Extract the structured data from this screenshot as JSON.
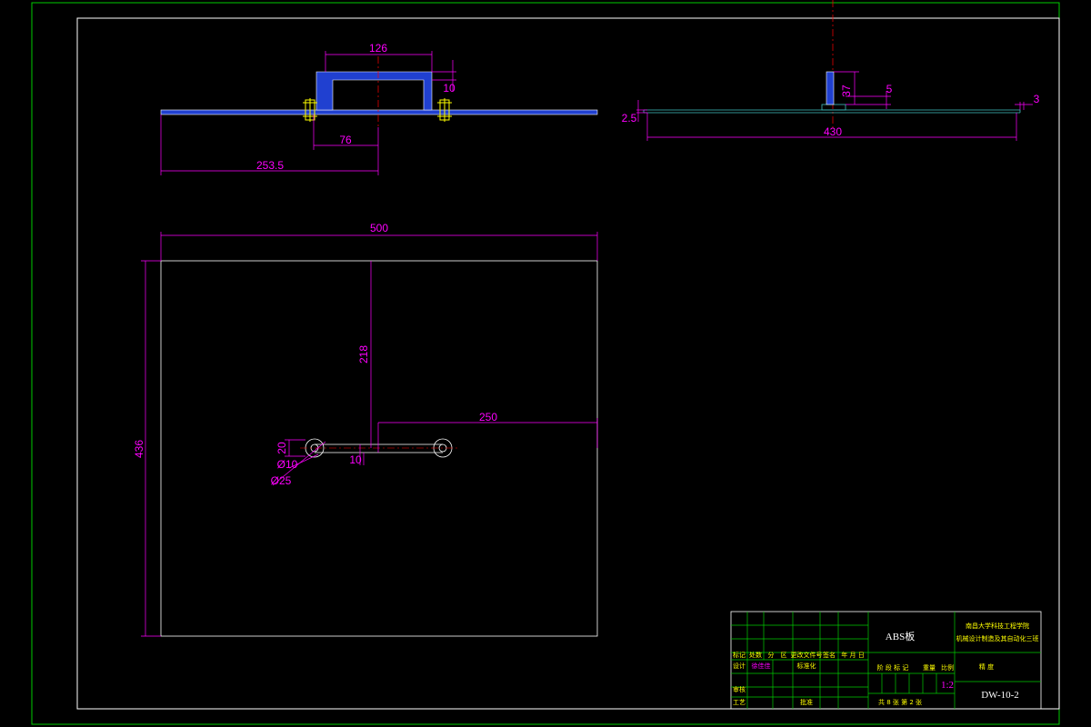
{
  "drawing": {
    "colors": {
      "background": "#000000",
      "border_outer": "#00cc00",
      "border_inner": "#ffffff",
      "dimension": "#ff00ff",
      "part_fill": "#2040d0",
      "outline": "#ffffff",
      "centerline": "#ff0000",
      "bolt": "#ffff00",
      "profile": "#40c0c0",
      "titleblock": "#00cc00"
    },
    "front_view": {
      "dim_width_top": "126",
      "dim_height": "10",
      "dim_offset": "76",
      "dim_total": "253.5"
    },
    "side_view": {
      "dim_plate_thk": "2.5",
      "dim_rib_height": "37",
      "dim_rib_width": "5",
      "dim_end": "3",
      "dim_length": "430"
    },
    "top_view": {
      "dim_width": "500",
      "dim_height": "436",
      "dim_center_y": "218",
      "dim_center_x": "250",
      "dim_link_h": "20",
      "dim_hole": "Ø10",
      "dim_boss": "Ø25",
      "dim_link_w": "10"
    },
    "title_block": {
      "part_name": "ABS板",
      "school_line1": "南昌大学科技工程学院",
      "school_line2": "机械设计制造及其自动化三班",
      "scale_label": "比例",
      "scale_value": "1:2",
      "drawing_no": "DW-10-2",
      "material_note": "精 度",
      "sheet_info": "共 8 张  第 2 张",
      "header_labels": [
        "标记",
        "处数",
        "分",
        "区",
        "更改文件号",
        "签名",
        "年 月 日"
      ],
      "design_label": "设计",
      "designer": "徐佳佳",
      "standard_label": "标准化",
      "review_label": "审核",
      "process_label": "工艺",
      "approve_label": "批准",
      "stage_labels": [
        "阶 段 标 记",
        "重量",
        "比例"
      ]
    }
  }
}
